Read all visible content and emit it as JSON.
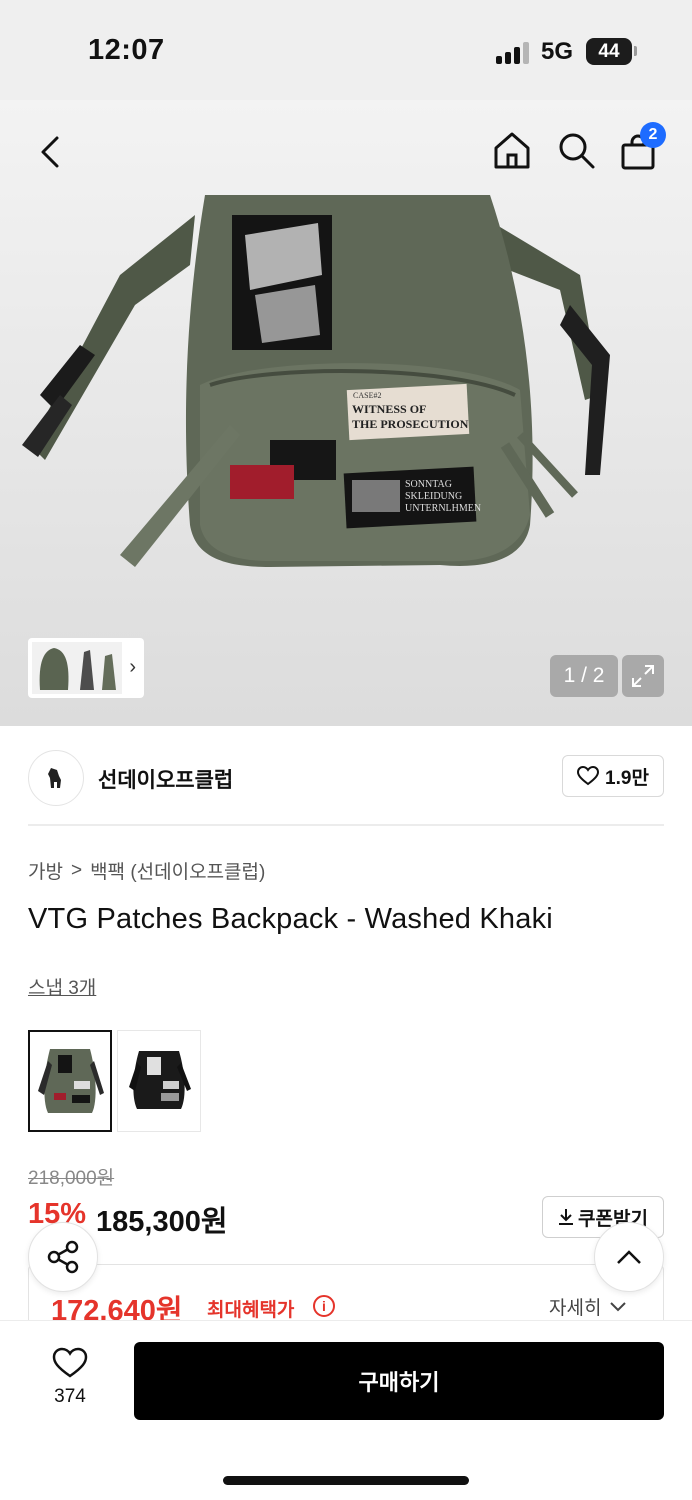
{
  "status_bar": {
    "time": "12:07",
    "network": "5G",
    "battery": "44"
  },
  "header": {
    "cart_count": "2"
  },
  "gallery": {
    "page_indicator": "1 / 2",
    "thumb_chevron": "›"
  },
  "brand": {
    "name": "선데이오프클럽",
    "likes": "1.9만"
  },
  "breadcrumb": {
    "category": "가방",
    "separator": ">",
    "subcategory": "백팩 (선데이오프클럽)"
  },
  "product": {
    "title": "VTG Patches Backpack - Washed Khaki",
    "snap_link": "스냅 3개",
    "patch_text_1": "WITNESS OF THE PROSECUTION",
    "patch_case": "CASE#2",
    "patch_text_2": "SONNTAG SKLEIDUNG UNTERNLHMEN STRR"
  },
  "pricing": {
    "original_price": "218,000원",
    "discount": "15%",
    "sale_price": "185,300원",
    "coupon_label": "쿠폰받기",
    "benefit_price": "172,640원",
    "benefit_label": "최대혜택가",
    "info_symbol": "i",
    "detail_label": "자세히"
  },
  "bottom_bar": {
    "wish_count": "374",
    "buy_label": "구매하기"
  },
  "colors": {
    "accent_red": "#e5342b",
    "badge_blue": "#1e6cff",
    "khaki": "#5f6857"
  },
  "icons": [
    "back-icon",
    "home-icon",
    "search-icon",
    "cart-icon",
    "expand-icon",
    "heart-icon",
    "download-icon",
    "info-icon",
    "chevron-down-icon",
    "share-icon",
    "chevron-up-icon"
  ]
}
